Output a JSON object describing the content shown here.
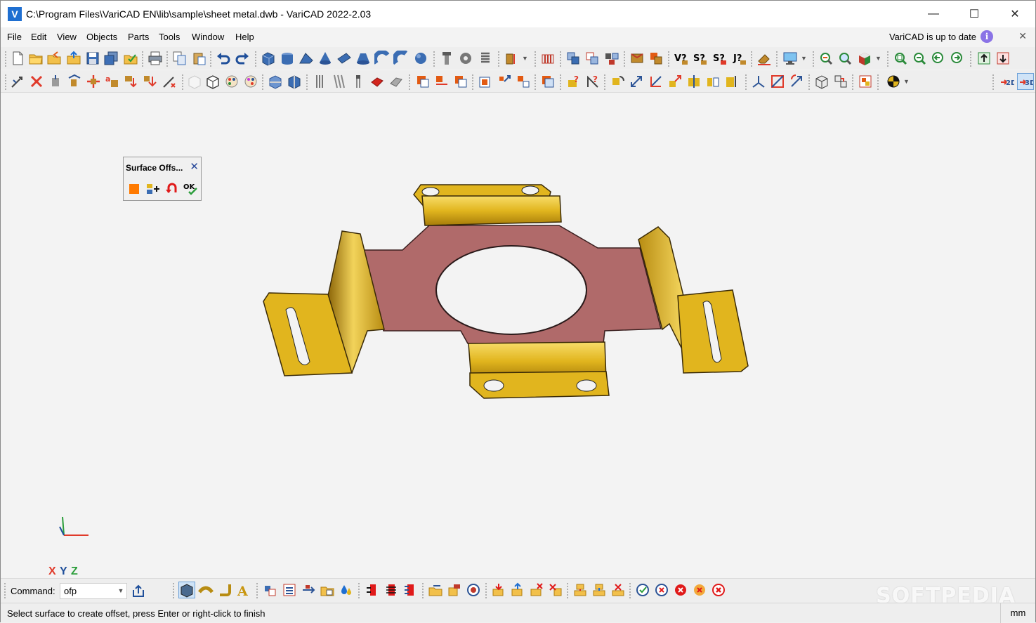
{
  "window": {
    "title": "C:\\Program Files\\VariCAD EN\\lib\\sample\\sheet metal.dwb - VariCAD 2022-2.03",
    "logo_letter": "V",
    "minimize": "—",
    "maximize": "☐",
    "close": "✕"
  },
  "menu": {
    "items": [
      "File",
      "Edit",
      "View",
      "Objects",
      "Parts",
      "Tools",
      "Window",
      "Help"
    ],
    "update_status": "VariCAD is up to date",
    "info_glyph": "i",
    "close_glyph": "✕"
  },
  "colors": {
    "sheet_gold": "#e1b51e",
    "sheet_face": "#b06a6a",
    "accent": "#1f6fd1"
  },
  "dialog": {
    "title": "Surface Offs...",
    "close_glyph": "✕",
    "ok_label": "OK"
  },
  "axes": {
    "x": "X",
    "y": "Y",
    "z": "Z"
  },
  "command": {
    "label": "Command:",
    "value": "ofp"
  },
  "status": {
    "message": "Select surface to create offset, press Enter or right-click to finish",
    "units": "mm"
  },
  "watermark": "SOFTPEDIA"
}
